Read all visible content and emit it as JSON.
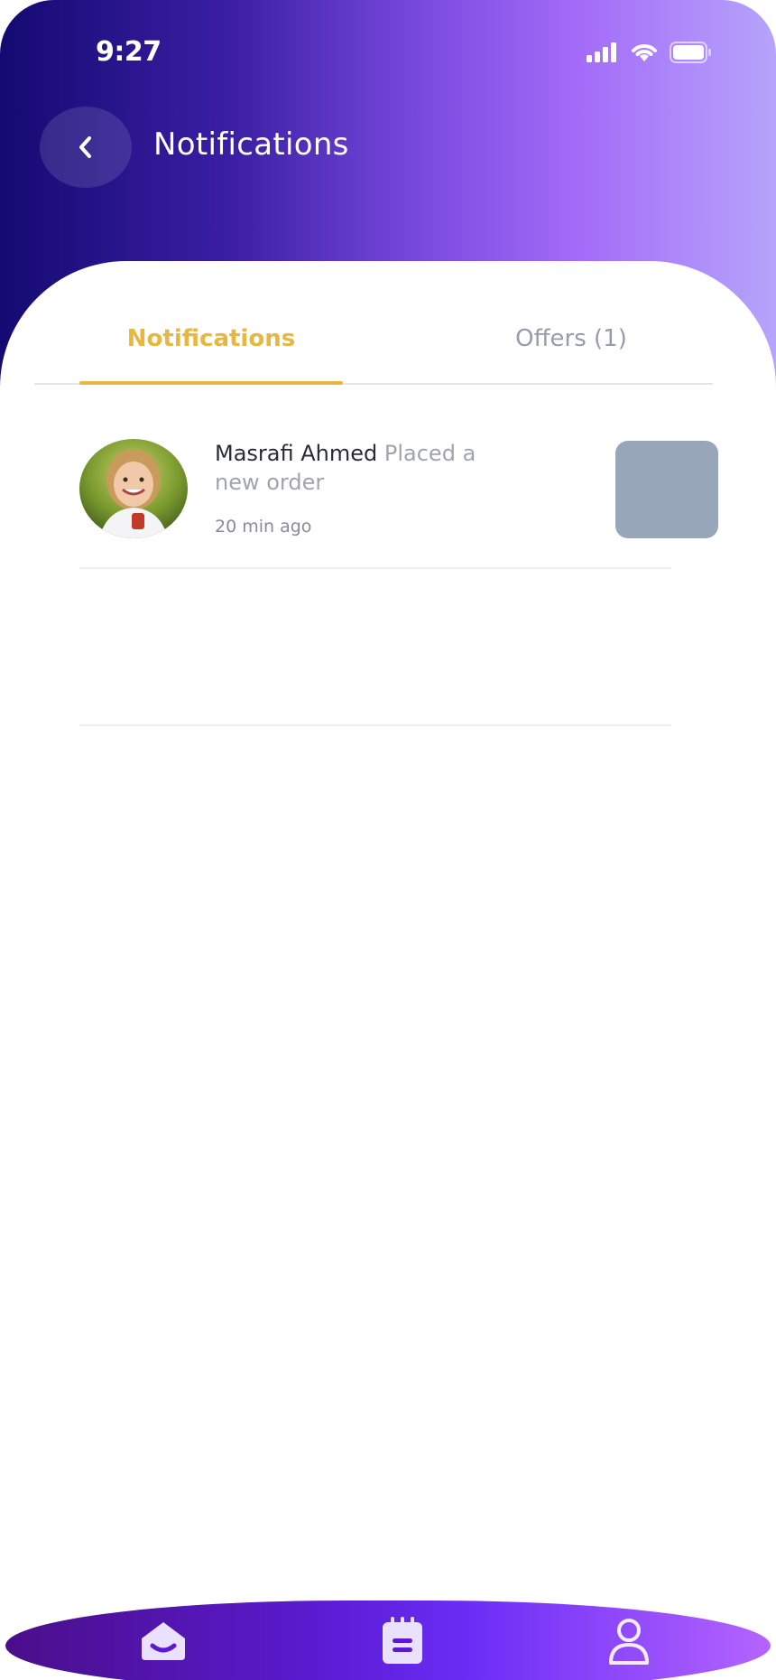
{
  "status_bar": {
    "time": "9:27"
  },
  "header": {
    "title": "Notifications",
    "back_icon": "chevron-left-icon"
  },
  "tabs": [
    {
      "label": "Notifications",
      "active": true
    },
    {
      "label": "Offers (1)",
      "active": false
    }
  ],
  "notifications": [
    {
      "name": "Masrafi Ahmed",
      "message": "Placed a new order",
      "time": "20 min ago"
    }
  ],
  "bottom_nav": {
    "items": [
      "home-icon",
      "orders-icon",
      "profile-icon"
    ]
  },
  "colors": {
    "accent": "#e7b73f",
    "header_gradient_start": "#140a72",
    "header_gradient_end": "#b6a4fb",
    "nav_gradient_start": "#4a0e8a",
    "nav_gradient_end": "#b464ff"
  }
}
